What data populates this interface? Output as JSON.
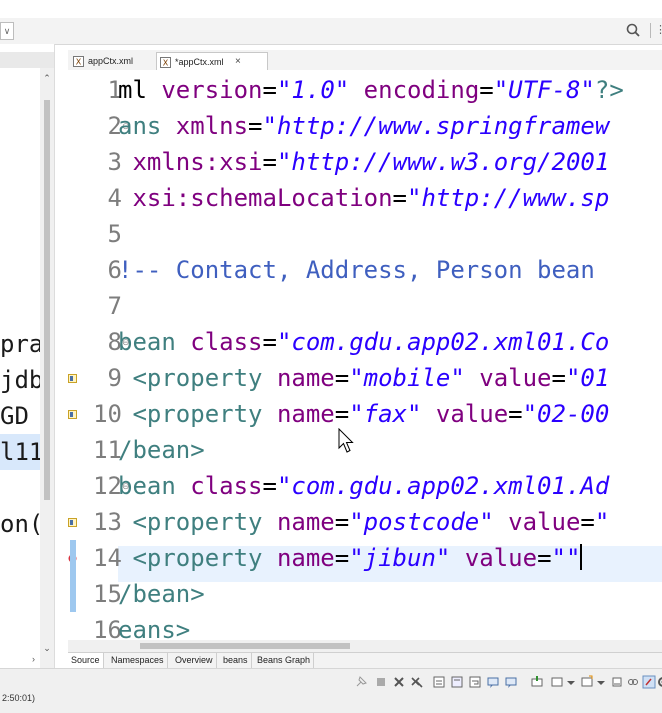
{
  "tabs": [
    {
      "label": "appCtx.xml",
      "active": false
    },
    {
      "label": "*appCtx.xml",
      "active": true
    }
  ],
  "left_pane": {
    "lines": [
      {
        "text": "pra",
        "selected": false
      },
      {
        "text": "jdb",
        "selected": false
      },
      {
        "text": "GD",
        "selected": false
      },
      {
        "text": "l11",
        "selected": true
      },
      {
        "text": "",
        "selected": false
      },
      {
        "text": "on(",
        "selected": false
      }
    ]
  },
  "editor": {
    "lines": [
      {
        "n": "1",
        "segments": [
          [
            "plain",
            "ml "
          ],
          [
            "attr",
            "version"
          ],
          [
            "plain",
            "="
          ],
          [
            "str",
            "\"1.0\""
          ],
          [
            "plain",
            " "
          ],
          [
            "attr",
            "encoding"
          ],
          [
            "plain",
            "="
          ],
          [
            "str",
            "\"UTF-8\""
          ],
          [
            "tag",
            "?>"
          ]
        ]
      },
      {
        "n": "2",
        "fold": true,
        "segments": [
          [
            "tag",
            "ans "
          ],
          [
            "attr",
            "xmlns"
          ],
          [
            "plain",
            "="
          ],
          [
            "str",
            "\"http://www.springframew"
          ]
        ]
      },
      {
        "n": "3",
        "segments": [
          [
            "plain",
            " "
          ],
          [
            "attr",
            "xmlns:xsi"
          ],
          [
            "plain",
            "="
          ],
          [
            "str",
            "\"http://www.w3.org/2001"
          ]
        ]
      },
      {
        "n": "4",
        "segments": [
          [
            "plain",
            " "
          ],
          [
            "attr",
            "xsi:schemaLocation"
          ],
          [
            "plain",
            "="
          ],
          [
            "str",
            "\"http://www.sp"
          ]
        ]
      },
      {
        "n": "5",
        "segments": []
      },
      {
        "n": "6",
        "segments": [
          [
            "comment",
            "!-- Contact, Address, Person bean"
          ]
        ]
      },
      {
        "n": "7",
        "segments": []
      },
      {
        "n": "8",
        "fold": true,
        "segments": [
          [
            "tag",
            "bean "
          ],
          [
            "attr",
            "class"
          ],
          [
            "plain",
            "="
          ],
          [
            "str",
            "\"com.gdu.app02.xml01.Co"
          ]
        ]
      },
      {
        "n": "9",
        "marker": "warn",
        "segments": [
          [
            "plain",
            " "
          ],
          [
            "tag",
            "<property "
          ],
          [
            "attr",
            "name"
          ],
          [
            "plain",
            "="
          ],
          [
            "str",
            "\"mobile\""
          ],
          [
            "plain",
            " "
          ],
          [
            "attr",
            "value"
          ],
          [
            "plain",
            "="
          ],
          [
            "str",
            "\"01"
          ]
        ]
      },
      {
        "n": "10",
        "marker": "warn",
        "segments": [
          [
            "plain",
            " "
          ],
          [
            "tag",
            "<property "
          ],
          [
            "attr",
            "name"
          ],
          [
            "plain",
            "="
          ],
          [
            "str",
            "\"fax\""
          ],
          [
            "plain",
            " "
          ],
          [
            "attr",
            "value"
          ],
          [
            "plain",
            "="
          ],
          [
            "str",
            "\"02-00"
          ]
        ]
      },
      {
        "n": "11",
        "segments": [
          [
            "tag",
            "/bean>"
          ]
        ]
      },
      {
        "n": "12",
        "fold": true,
        "segments": [
          [
            "tag",
            "bean "
          ],
          [
            "attr",
            "class"
          ],
          [
            "plain",
            "="
          ],
          [
            "str",
            "\"com.gdu.app02.xml01.Ad"
          ]
        ]
      },
      {
        "n": "13",
        "marker": "warn",
        "segments": [
          [
            "plain",
            " "
          ],
          [
            "tag",
            "<property "
          ],
          [
            "attr",
            "name"
          ],
          [
            "plain",
            "="
          ],
          [
            "str",
            "\"postcode\""
          ],
          [
            "plain",
            " "
          ],
          [
            "attr",
            "value"
          ],
          [
            "plain",
            "="
          ],
          [
            "str",
            "\""
          ]
        ]
      },
      {
        "n": "14",
        "marker": "error",
        "current": true,
        "caret": true,
        "segments": [
          [
            "plain",
            " "
          ],
          [
            "tag",
            "<property "
          ],
          [
            "attr",
            "name"
          ],
          [
            "plain",
            "="
          ],
          [
            "str",
            "\"jibun\""
          ],
          [
            "plain",
            " "
          ],
          [
            "attr",
            "value"
          ],
          [
            "plain",
            "="
          ],
          [
            "str",
            "\"\""
          ]
        ]
      },
      {
        "n": "15",
        "segments": [
          [
            "tag",
            "/bean>"
          ]
        ]
      },
      {
        "n": "16",
        "segments": [
          [
            "tag",
            "eans>"
          ]
        ]
      }
    ]
  },
  "bottom_tabs": [
    {
      "label": "Source",
      "active": true
    },
    {
      "label": "Namespaces",
      "active": false
    },
    {
      "label": "Overview",
      "active": false
    },
    {
      "label": "beans",
      "active": false
    },
    {
      "label": "Beans Graph",
      "active": false
    }
  ],
  "status": {
    "timestamp": "2:50:01)"
  },
  "colors": {
    "tag": "#3f7f7f",
    "attr": "#7f007f",
    "string": "#2a00ff",
    "comment": "#3f5fbf",
    "current_line": "#e8f2fe"
  },
  "icons": {
    "search": "search-icon",
    "tab_file": "xml-file-icon",
    "tab_close": "close-icon",
    "error_marker": "error-marker-icon",
    "warning_marker": "warning-marker-icon"
  }
}
